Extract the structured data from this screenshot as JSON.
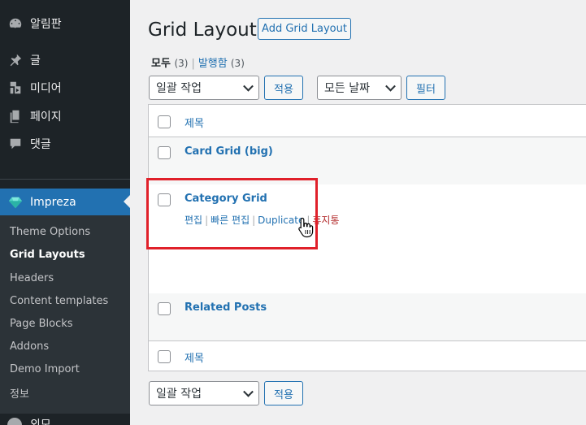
{
  "sidebar": {
    "items": [
      {
        "label": "알림판",
        "icon": "dashboard-icon"
      },
      {
        "label": "글",
        "icon": "pin-icon"
      },
      {
        "label": "미디어",
        "icon": "media-icon"
      },
      {
        "label": "페이지",
        "icon": "pages-icon"
      },
      {
        "label": "댓글",
        "icon": "comments-icon"
      }
    ],
    "active": {
      "label": "Impreza",
      "icon": "impreza-gem-icon"
    },
    "submenu": [
      "Theme Options",
      "Grid Layouts",
      "Headers",
      "Content templates",
      "Page Blocks",
      "Addons",
      "Demo Import",
      "정보"
    ],
    "current_submenu": "Grid Layouts",
    "partial_bottom": "외모"
  },
  "header": {
    "title": "Grid Layouts",
    "add_button": "Add Grid Layout"
  },
  "filters": {
    "all_label": "모두",
    "all_count": "(3)",
    "published_label": "발행함",
    "published_count": "(3)"
  },
  "toolbar": {
    "bulk_action": "일괄 작업",
    "apply": "적용",
    "date_filter": "모든 날짜",
    "filter_button": "필터"
  },
  "table": {
    "header_title": "제목",
    "footer_title": "제목",
    "rows": [
      {
        "title": "Card Grid (big)"
      },
      {
        "title": "Category Grid",
        "actions": [
          "편집",
          "빠른 편집",
          "Duplicate",
          "휴지통"
        ]
      },
      {
        "title": "Related Posts"
      }
    ]
  },
  "bottom_toolbar": {
    "bulk_action": "일괄 작업",
    "apply": "적용"
  },
  "colors": {
    "accent": "#2271b1",
    "sidebar_bg": "#1d2327",
    "trash": "#b32d2e",
    "highlight": "#e0202a"
  }
}
